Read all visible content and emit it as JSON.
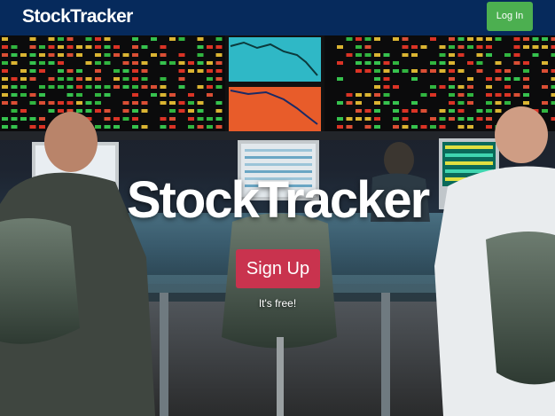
{
  "navbar": {
    "brand": "StockTracker",
    "login_label": "Log In",
    "background_color": "#062a5c",
    "login_color": "#4caf50"
  },
  "hero": {
    "title": "StockTracker",
    "signup_label": "Sign Up",
    "subtitle": "It's free!",
    "signup_color": "#c9334e",
    "background_image": "stock-exchange-trading-floor-photo"
  }
}
